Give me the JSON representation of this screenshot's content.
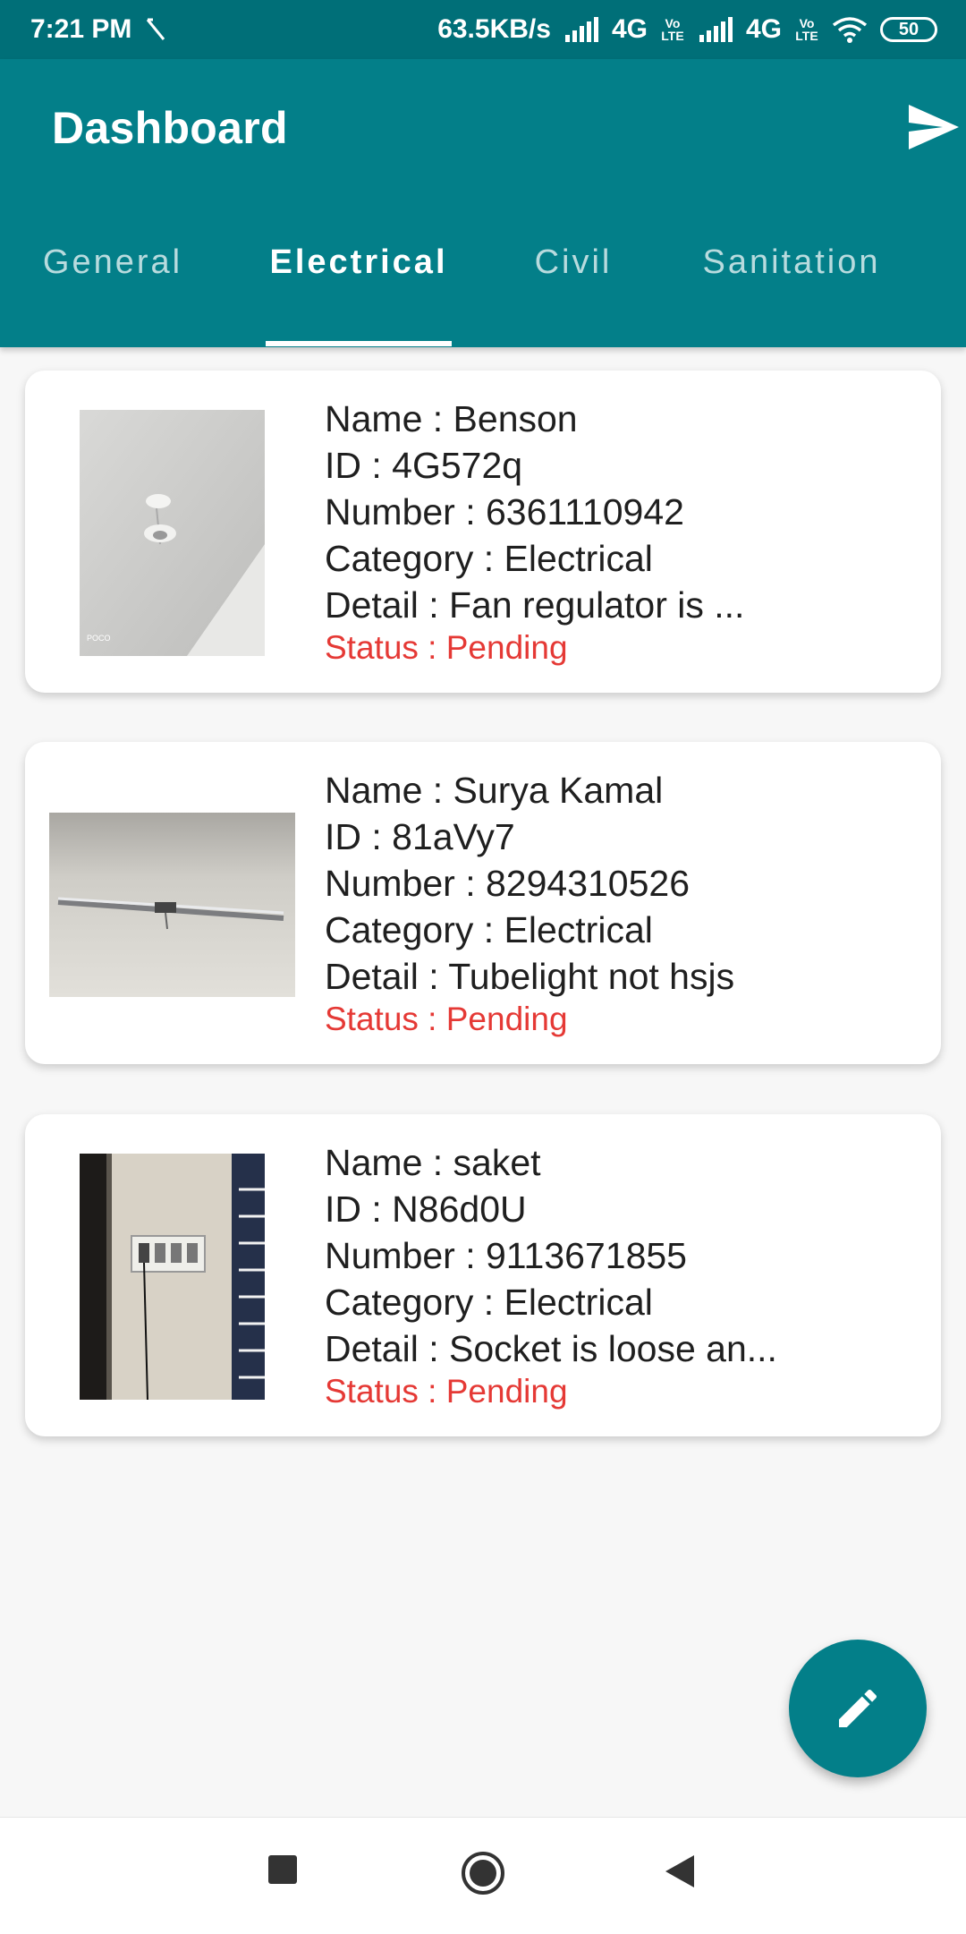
{
  "status_bar": {
    "time": "7:21 PM",
    "network_speed": "63.5KB/s",
    "network1": "4G",
    "network2": "4G",
    "volte1": "Vo LTE",
    "volte2": "Vo LTE",
    "battery": "50"
  },
  "app_bar": {
    "title": "Dashboard",
    "send_icon": "send-icon"
  },
  "tabs": [
    {
      "label": "General",
      "active": false
    },
    {
      "label": "Electrical",
      "active": true
    },
    {
      "label": "Civil",
      "active": false
    },
    {
      "label": "Sanitation",
      "active": false
    }
  ],
  "complaints": [
    {
      "name": "Name : Benson",
      "id": "ID : 4G572q",
      "number": "Number : 6361110942",
      "category": "Category : Electrical",
      "detail": "Detail : Fan regulator is ...",
      "status": "Status : Pending",
      "image_caption": "POCO"
    },
    {
      "name": "Name : Surya Kamal",
      "id": "ID : 81aVy7",
      "number": "Number : 8294310526",
      "category": "Category : Electrical",
      "detail": "Detail : Tubelight not hsjs",
      "status": "Status : Pending"
    },
    {
      "name": "Name : saket",
      "id": "ID : N86d0U",
      "number": "Number : 9113671855",
      "category": "Category : Electrical",
      "detail": "Detail : Socket is loose an...",
      "status": "Status : Pending"
    }
  ],
  "fab": {
    "icon": "edit-icon"
  },
  "nav": {
    "recents_icon": "square-icon",
    "home_icon": "circle-icon",
    "back_icon": "triangle-icon"
  },
  "colors": {
    "primary": "#037f89",
    "status_bar": "#006f78",
    "pending": "#e53935"
  }
}
